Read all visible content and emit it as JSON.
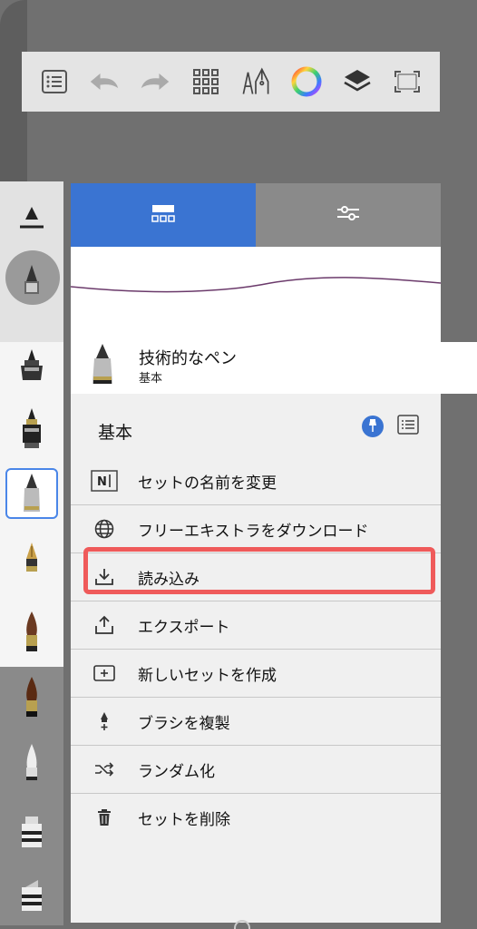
{
  "toolbar": {
    "icons": [
      "list-icon",
      "undo-icon",
      "redo-icon",
      "grid-icon",
      "brush-pens-icon",
      "color-wheel-icon",
      "layers-icon",
      "fullscreen-icon"
    ]
  },
  "brush_panel": {
    "tabs": [
      "brush-set-tab-icon",
      "brush-settings-tab-icon"
    ],
    "selected_brush": {
      "name": "技術的なペン",
      "set": "基本"
    },
    "set_title": "基本",
    "menu": [
      {
        "icon": "rename-icon",
        "label": "セットの名前を変更"
      },
      {
        "icon": "globe-icon",
        "label": "フリーエキストラをダウンロード"
      },
      {
        "icon": "import-icon",
        "label": "読み込み"
      },
      {
        "icon": "export-icon",
        "label": "エクスポート"
      },
      {
        "icon": "new-set-icon",
        "label": "新しいセットを作成"
      },
      {
        "icon": "duplicate-brush-icon",
        "label": "ブラシを複製"
      },
      {
        "icon": "shuffle-icon",
        "label": "ランダム化"
      },
      {
        "icon": "trash-icon",
        "label": "セットを削除"
      }
    ]
  },
  "colors": {
    "accent": "#3a74d2",
    "highlight": "#ef5a5a",
    "stroke": "#6b3a6b"
  }
}
